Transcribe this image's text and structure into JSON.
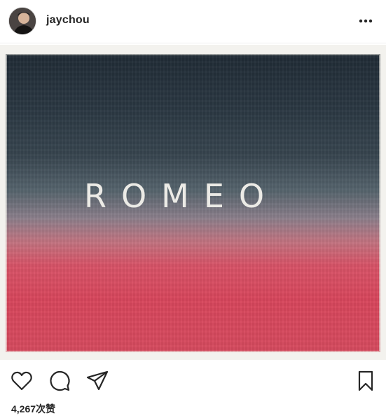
{
  "header": {
    "username": "jaychou",
    "avatar_icon": "profile-photo-icon",
    "more_icon": "more-options-icon"
  },
  "post": {
    "image_text": "ROMEO"
  },
  "actions": {
    "like_icon": "heart-icon",
    "comment_icon": "comment-bubble-icon",
    "share_icon": "paper-plane-icon",
    "save_icon": "bookmark-icon"
  },
  "likes_text": "4,267次赞",
  "colors": {
    "text": "#262626",
    "painting_top": "#202b35",
    "painting_bottom": "#d64a5e",
    "frame": "#f3f2ee"
  }
}
